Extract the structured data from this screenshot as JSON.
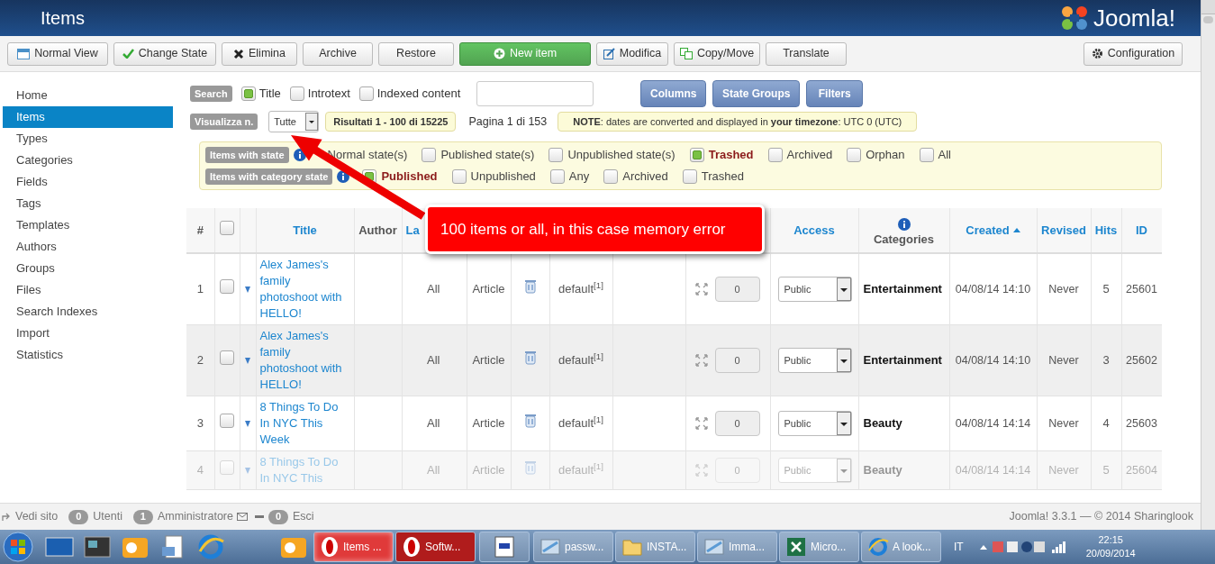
{
  "header": {
    "title": "Items",
    "logo_text": "Joomla!"
  },
  "toolbar": [
    {
      "label": "Normal View",
      "kind": "default"
    },
    {
      "label": "Change State",
      "kind": "default"
    },
    {
      "label": "Elimina",
      "kind": "default"
    },
    {
      "label": "Archive",
      "kind": "default"
    },
    {
      "label": "Restore",
      "kind": "default"
    },
    {
      "label": "New item",
      "kind": "primary"
    },
    {
      "label": "Modifica",
      "kind": "default"
    },
    {
      "label": "Copy/Move",
      "kind": "default"
    },
    {
      "label": "Translate",
      "kind": "default"
    },
    {
      "label": "Configuration",
      "kind": "right"
    }
  ],
  "sidebar": {
    "items": [
      {
        "label": "Home",
        "selected": false
      },
      {
        "label": "Items",
        "selected": true
      },
      {
        "label": "Types",
        "selected": false
      },
      {
        "label": "Categories",
        "selected": false
      },
      {
        "label": "Fields",
        "selected": false
      },
      {
        "label": "Tags",
        "selected": false
      },
      {
        "label": "Templates",
        "selected": false
      },
      {
        "label": "Authors",
        "selected": false
      },
      {
        "label": "Groups",
        "selected": false
      },
      {
        "label": "Files",
        "selected": false
      },
      {
        "label": "Search Indexes",
        "selected": false
      },
      {
        "label": "Import",
        "selected": false
      },
      {
        "label": "Statistics",
        "selected": false
      }
    ]
  },
  "search": {
    "label": "Search",
    "options": [
      {
        "label": "Title",
        "checked": true
      },
      {
        "label": "Introtext",
        "checked": false
      },
      {
        "label": "Indexed content",
        "checked": false
      }
    ],
    "buttons": [
      "Columns",
      "State Groups",
      "Filters"
    ]
  },
  "display": {
    "label": "Visualizza n.",
    "value": "Tutte",
    "results": "Risultati 1 - 100 di 15225",
    "page": "Pagina 1 di 153",
    "note": "**NOTE**: dates are converted and displayed in **your timezone**: UTC 0 (UTC)"
  },
  "filters": [
    {
      "label": "Items with state",
      "options": [
        {
          "label": "Normal state(s)"
        },
        {
          "label": "Published state(s)",
          "checked": false
        },
        {
          "label": "Unpublished state(s)",
          "checked": false
        },
        {
          "label": "Trashed",
          "checked": true
        },
        {
          "label": "Archived",
          "checked": false
        },
        {
          "label": "Orphan",
          "checked": false
        },
        {
          "label": "All",
          "checked": false
        }
      ]
    },
    {
      "label": "Items with category state",
      "options": [
        {
          "label": "Published",
          "checked": true
        },
        {
          "label": "Unpublished",
          "checked": false
        },
        {
          "label": "Any",
          "checked": false
        },
        {
          "label": "Archived",
          "checked": false
        },
        {
          "label": "Trashed",
          "checked": false
        }
      ]
    }
  ],
  "table": {
    "columns": [
      {
        "kind": "plain",
        "label": "#"
      },
      {
        "kind": "checkbox",
        "checked": false
      },
      {
        "kind": "blank"
      },
      {
        "kind": "link",
        "label": "Title"
      },
      {
        "kind": "plain",
        "label": "Author"
      },
      {
        "kind": "link",
        "label": "La"
      },
      {
        "kind": "blank"
      },
      {
        "kind": "blank"
      },
      {
        "kind": "blank"
      },
      {
        "kind": "blank"
      },
      {
        "kind": "blank"
      },
      {
        "kind": "link",
        "label": "Access"
      },
      {
        "kind": "info",
        "label": "Categories"
      },
      {
        "kind": "link",
        "label": "Created",
        "sort_ascending": true
      },
      {
        "kind": "link",
        "label": "Revised"
      },
      {
        "kind": "link",
        "label": "Hits"
      },
      {
        "kind": "link",
        "label": "ID"
      }
    ],
    "rows": [
      {
        "num": "1",
        "checked": false,
        "title": "Alex James's family photoshoot with HELLO!",
        "language": "All",
        "type": "Article",
        "layout": "default$^{[1]}$",
        "ordering": "0",
        "access": "Public",
        "category": "Entertainment",
        "created": "04/08/14 14:10",
        "revised": "Never",
        "hits": "5",
        "id": "25601",
        "faded": false
      },
      {
        "num": "2",
        "checked": false,
        "title": "Alex James's family photoshoot with HELLO!",
        "language": "All",
        "type": "Article",
        "layout": "default$^{[1]}$",
        "ordering": "0",
        "access": "Public",
        "category": "Entertainment",
        "created": "04/08/14 14:10",
        "revised": "Never",
        "hits": "3",
        "id": "25602",
        "faded": false
      },
      {
        "num": "3",
        "checked": false,
        "title": "8 Things To Do In NYC This Week",
        "language": "All",
        "type": "Article",
        "layout": "default$^{[1]}$",
        "ordering": "0",
        "access": "Public",
        "category": "Beauty",
        "created": "04/08/14 14:14",
        "revised": "Never",
        "hits": "4",
        "id": "25603",
        "faded": false
      },
      {
        "num": "4",
        "checked": false,
        "title": "8 Things To Do In NYC This",
        "language": "All",
        "type": "Article",
        "layout": "default$^{[1]}$",
        "ordering": "0",
        "access": "Public",
        "category": "Beauty",
        "created": "04/08/14 14:14",
        "revised": "Never",
        "hits": "5",
        "id": "25604",
        "faded": true
      }
    ]
  },
  "callout": {
    "text": "100 items or all, in this case memory error"
  },
  "footer": {
    "links": [
      {
        "label": "Vedi sito"
      },
      {
        "count": "0",
        "label": "Utenti"
      },
      {
        "count": "1",
        "label": "Amministratore"
      },
      {
        "count": "0",
        "label": "Esci"
      }
    ],
    "version": "Joomla! 3.3.1 — © 2014 Sharinglook"
  },
  "taskbar": {
    "tasks": [
      {
        "label": "Items ...",
        "kind": "opera",
        "selected": true
      },
      {
        "label": "Softw...",
        "kind": "opera",
        "selected": false
      },
      {
        "label": "passw...",
        "kind": "file"
      },
      {
        "label": "INSTA...",
        "kind": "folder"
      },
      {
        "label": "Imma...",
        "kind": "file"
      },
      {
        "label": "Micro...",
        "kind": "excel"
      },
      {
        "label": "A look...",
        "kind": "ie"
      }
    ],
    "language": "IT",
    "time": "22:15",
    "date": "20/09/2014"
  }
}
